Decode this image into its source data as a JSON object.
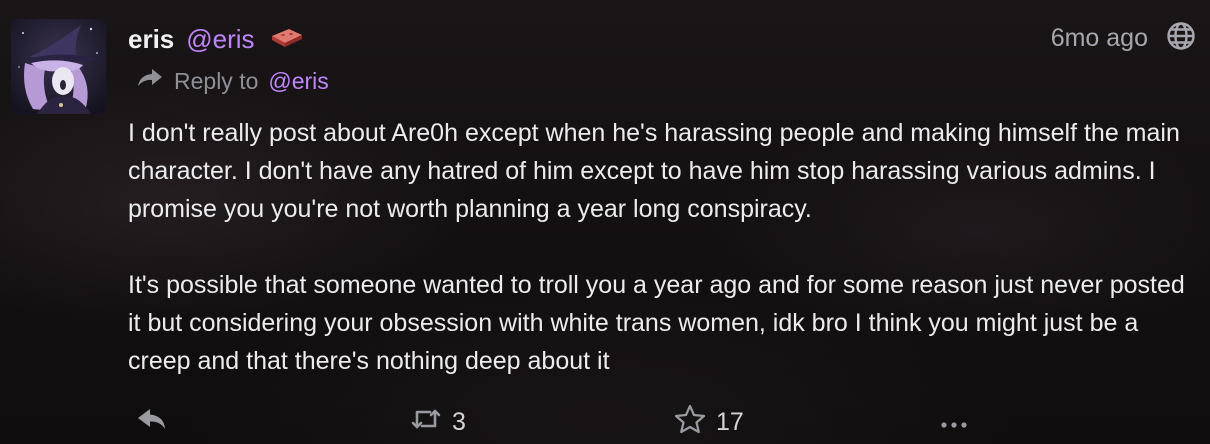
{
  "post": {
    "author": {
      "display_name": "eris",
      "handle": "@eris",
      "badge_icon": "brick-icon"
    },
    "timestamp": "6mo ago",
    "visibility_icon": "globe-icon",
    "reply_to": {
      "label": "Reply to",
      "handle": "@eris"
    },
    "paragraphs": [
      "I don't really post about Are0h except when he's harassing people and making himself the main character. I don't have any hatred of him except to have him stop harassing various admins. I promise you you're not worth planning a year long conspiracy.",
      "It's possible that someone wanted to troll you a year ago and for some reason just never posted it but considering your obsession with white trans women, idk bro I think you might just be a creep and that there's nothing deep about it"
    ],
    "actions": {
      "reply_icon": "reply-icon",
      "boost_icon": "retweet-icon",
      "boost_count": "3",
      "favorite_icon": "star-icon",
      "favorite_count": "17",
      "more_icon": "ellipsis-icon"
    }
  },
  "colors": {
    "accent": "#c084fc",
    "muted": "#9a9aa1",
    "text": "#ececef"
  }
}
